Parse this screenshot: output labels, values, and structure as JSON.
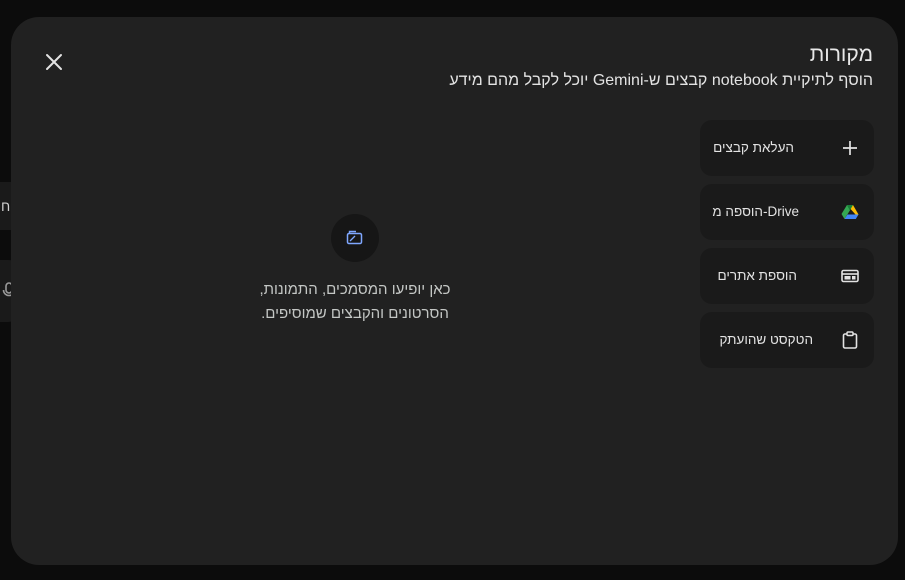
{
  "background": {
    "chip_fragment": "וח"
  },
  "dialog": {
    "title": "מקורות",
    "subtitle": "הוסף לתיקיית notebook קבצים ש-Gemini יוכל לקבל מהם מידע",
    "close_icon": "close-icon"
  },
  "options": [
    {
      "label": "העלאת קבצים",
      "icon": "plus-icon"
    },
    {
      "label": "הוספה מ-Drive",
      "icon": "google-drive-icon"
    },
    {
      "label": "הוספת אתרים",
      "icon": "website-icon"
    },
    {
      "label": "הטקסט שהועתק",
      "icon": "clipboard-icon"
    }
  ],
  "empty_state": {
    "icon": "sources-icon",
    "line1": "כאן יופיעו המסמכים, התמונות,",
    "line2": "הסרטונים והקבצים שמוסיפים."
  },
  "colors": {
    "dialog_bg": "#212121",
    "card_bg": "#1a1a1a",
    "accent_blue": "#7fa7ff"
  }
}
